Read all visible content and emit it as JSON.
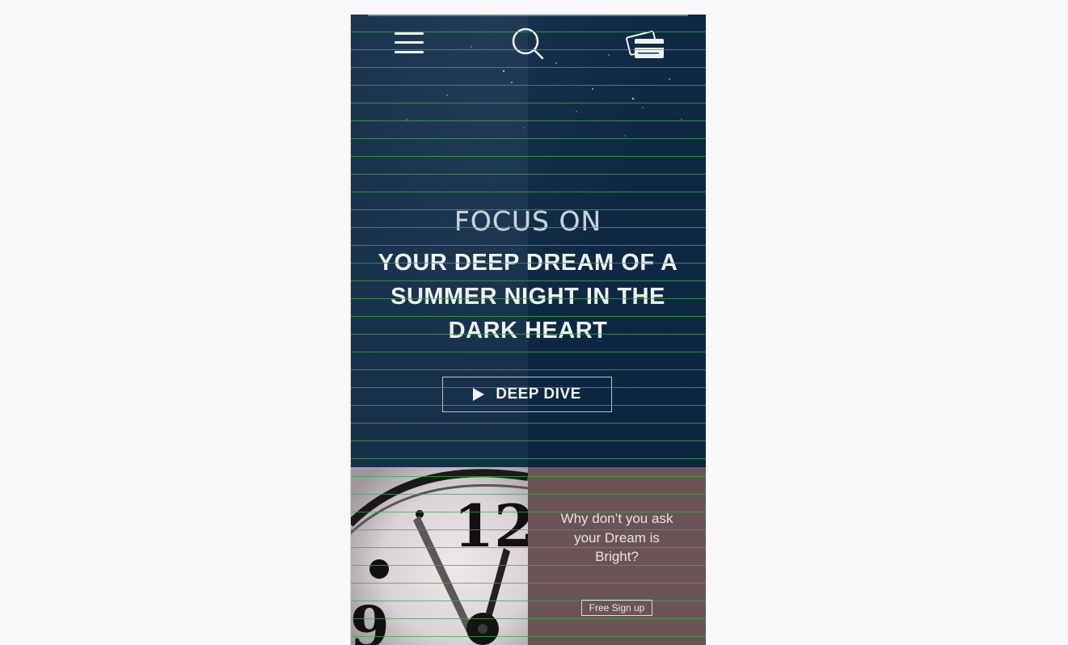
{
  "nav": {
    "menu_icon": "hamburger-menu-icon",
    "search_icon": "search-icon",
    "cart_icon": "credit-cards-icon"
  },
  "hero": {
    "kicker": "FOCUS ON",
    "headline": "YOUR DEEP DREAM OF A SUMMER NIGHT IN THE DARK HEART",
    "cta_label": "DEEP DIVE",
    "cta_icon": "play-icon"
  },
  "promo": {
    "question": "Why don’t you ask your Dream is Bright?",
    "signup_label": "Free Sign up",
    "background": "#6b5456"
  },
  "colors": {
    "hero_bg": "#132e49",
    "page_bg": "#f8f8f8",
    "grid_line": "#3caa46"
  }
}
